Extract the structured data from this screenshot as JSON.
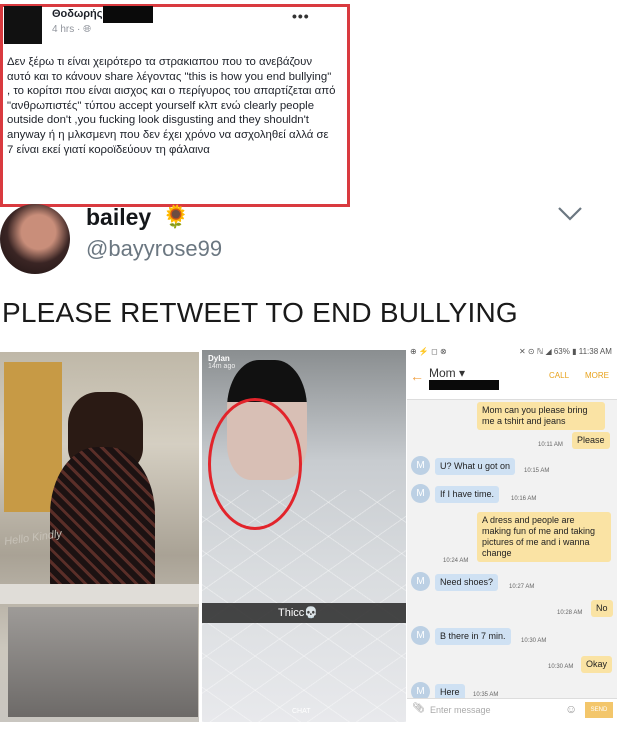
{
  "facebook_post": {
    "author": "Θοδωρής",
    "time": "4 hrs · ",
    "globe_icon": "globe-icon",
    "more": "•••",
    "body": "Δεν ξέρω τι είναι χειρότερο τα στρακιαπου που το ανεβάζουν αυτό και το κάνουν share λέγοντας \"this is how you end bullying\" , το κορίτσι που είναι αισχος και ο περίγυρος του απαρτίζεται από \"ανθρωπιστές\" τύπου accept yourself κλπ ενώ clearly people outside don't ,you fucking look disgusting and they shouldn't anyway ή η μλκσμενη που δεν έχει χρόνο να ασχοληθεί αλλά σε 7 είναι εκεί γιατί κοροϊδεύουν τη φάλαινα"
  },
  "tweet": {
    "name": "bailey",
    "emoji": "🌻",
    "handle": "@bayyrose99",
    "text": "PLEASE RETWEET TO END BULLYING"
  },
  "panel1": {
    "caption": "Hello Kindly"
  },
  "panel2": {
    "user": "Dylan",
    "time": "14m ago",
    "caption": "Thicc💀",
    "chat": "CHAT"
  },
  "sms": {
    "status_left": "⊕ ⚡ ◻ ⊗",
    "status_right": "✕ ⊙ ℕ ◢ 63% ▮ 11:38 AM",
    "back": "←",
    "contact": "Mom ▾",
    "call": "CALL",
    "more": "MORE",
    "messages": [
      {
        "dir": "out",
        "text": "Mom can you please bring me a tshirt and jeans",
        "time": ""
      },
      {
        "dir": "out",
        "text": "Please",
        "time": "10:11 AM"
      },
      {
        "dir": "in",
        "text": "U? What u got on",
        "time": "10:15 AM"
      },
      {
        "dir": "in",
        "text": "If I have time.",
        "time": "10:16 AM"
      },
      {
        "dir": "out",
        "text": "A dress and people are making fun of me and taking pictures of me and i wanna change",
        "time": "10:24 AM"
      },
      {
        "dir": "in",
        "text": "Need shoes?",
        "time": "10:27 AM"
      },
      {
        "dir": "out",
        "text": "No",
        "time": "10:28 AM"
      },
      {
        "dir": "in",
        "text": "B there in 7 min.",
        "time": "10:30 AM"
      },
      {
        "dir": "out",
        "text": "Okay",
        "time": "10:30 AM"
      },
      {
        "dir": "in",
        "text": "Here",
        "time": "10:35 AM"
      }
    ],
    "avatar_letter": "M",
    "input_placeholder": "Enter message",
    "send": "SEND"
  }
}
